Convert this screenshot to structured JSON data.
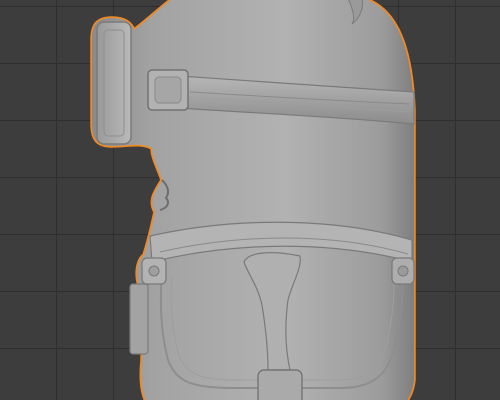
{
  "viewport": {
    "background_color": "#3d3d3d",
    "grid_color": "#2f2f2f",
    "selection_outline_color": "#f08a24",
    "object_base_color": "#a3a3a3"
  },
  "object": {
    "type": "sculpted-mesh",
    "selected": true,
    "features": [
      "goggle-strap",
      "goggle-lens",
      "strap-buckle",
      "overalls-bib",
      "belt-clip-left",
      "belt-clip-right",
      "side-pocket",
      "overalls-strap",
      "mouth-profile"
    ]
  },
  "icons": {
    "selection": "outline-highlight"
  }
}
